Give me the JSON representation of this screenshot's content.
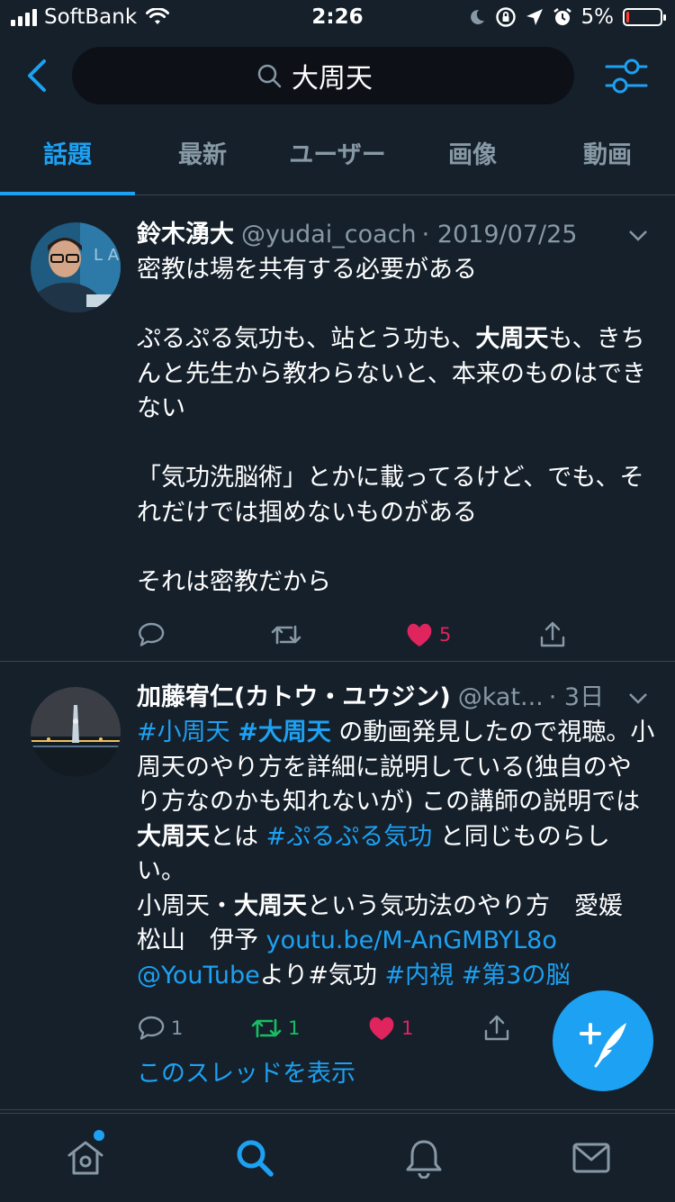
{
  "status_bar": {
    "carrier": "SoftBank",
    "time": "2:26",
    "battery_text": "5%",
    "battery_level": 0.05
  },
  "search": {
    "query": "大周天"
  },
  "tabs": [
    {
      "label": "話題",
      "active": true
    },
    {
      "label": "最新",
      "active": false
    },
    {
      "label": "ユーザー",
      "active": false
    },
    {
      "label": "画像",
      "active": false
    },
    {
      "label": "動画",
      "active": false
    }
  ],
  "tweets": [
    {
      "name": "鈴木湧大",
      "handle": "@yudai_coach",
      "date": "· 2019/07/25",
      "line1": "密教は場を共有する必要がある",
      "line2a": "ぷるぷる気功も、站とう功も、",
      "line2b": "大周天",
      "line2c": "も、きちんと先生から教わらないと、本来のものはできない",
      "line3": "「気功洗脳術」とかに載ってるけど、でも、それだけでは掴めないものがある",
      "line4": "それは密教だから",
      "likes": "5"
    },
    {
      "name": "加藤宥仁(カトウ・ユウジン)",
      "handle": "@kat...",
      "date": "· 3日",
      "tag_shoushuuten": "#小周天",
      "tag_daishuuten": "#大周天",
      "t1": " の動画発見したので視聴。小周天のやり方を詳細に説明している(独自のやり方なのかも知れないが) この講師の説明では",
      "t2": "大周天",
      "t3": "とは ",
      "tag_purupuru": "#ぷるぷる気功",
      "t4": " と同じものらしい。",
      "t5": "小周天・",
      "t6": "大周天",
      "t7": "という気功法のやり方　愛媛　松山　伊予 ",
      "link": "youtu.be/M-AnGMBYL8o",
      "youtube": "@YouTube",
      "t8": "より#気功 ",
      "tag_naishi": "#内視",
      "tag_dai3": "#第3の脳",
      "replies": "1",
      "retweets": "1",
      "likes": "1",
      "thread": "このスレッドを表示"
    }
  ],
  "colors": {
    "accent": "#1da1f2",
    "like": "#e0245e",
    "retweet": "#17bf63",
    "bg": "#15202b"
  }
}
